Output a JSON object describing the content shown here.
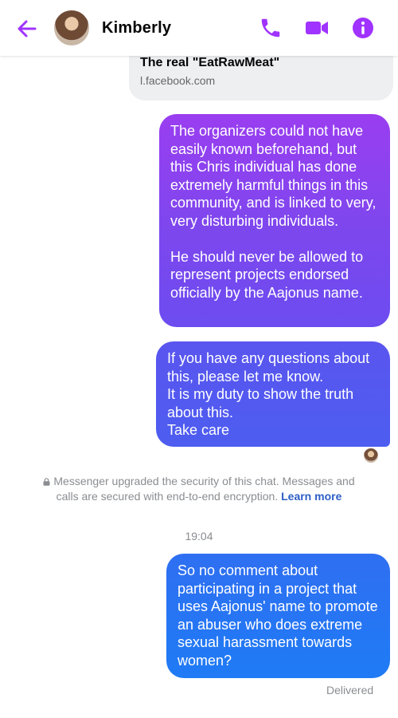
{
  "header": {
    "contact_name": "Kimberly",
    "icons": [
      "back-arrow-icon",
      "phone-icon",
      "video-camera-icon",
      "info-icon"
    ],
    "accent_color": "#a033ff"
  },
  "link_preview": {
    "title": "The real \"EatRawMeat\"",
    "domain": "l.facebook.com"
  },
  "messages": [
    {
      "direction": "outgoing",
      "text": "The organizers could not have easily known beforehand, but this Chris individual has done extremely harmful things in this community, and is linked to very, very disturbing individuals.\n\nHe should never be allowed to represent projects endorsed officially by the Aajonus name."
    },
    {
      "direction": "outgoing",
      "text": "If you have any questions about this, please let me know.\nIt is my duty to show the truth about this.\nTake care"
    },
    {
      "direction": "outgoing",
      "text": "So no comment about participating in a project that uses Aajonus' name to promote an abuser who does extreme sexual harassment towards women?"
    }
  ],
  "security_notice": {
    "text": "Messenger upgraded the security of this chat. Messages and calls are secured with end-to-end encryption.",
    "link": "Learn more"
  },
  "timestamp": "19:04",
  "status": "Delivered"
}
